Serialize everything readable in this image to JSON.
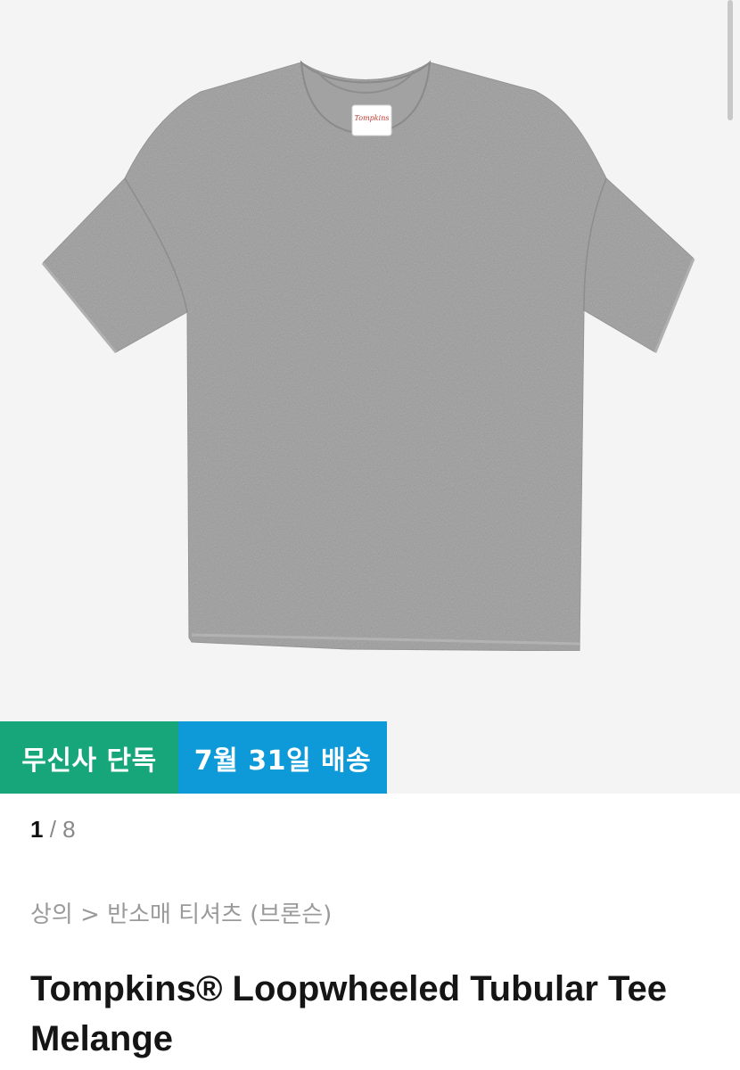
{
  "product": {
    "image_alt": "Tompkins heather gray short sleeve t-shirt",
    "neck_label_text": "Tompkins",
    "badges": {
      "exclusive": "무신사 단독",
      "delivery": "7월 31일 배송"
    },
    "gallery": {
      "current": "1",
      "separator": " / ",
      "total": "8"
    },
    "breadcrumb": "상의 > 반소매 티셔츠 (브론슨)",
    "title": "Tompkins® Loopwheeled Tubular Tee Melange"
  },
  "colors": {
    "exclusive_badge": "#16a67a",
    "delivery_badge": "#0e9ad8",
    "shirt": "#9b9b9b"
  }
}
